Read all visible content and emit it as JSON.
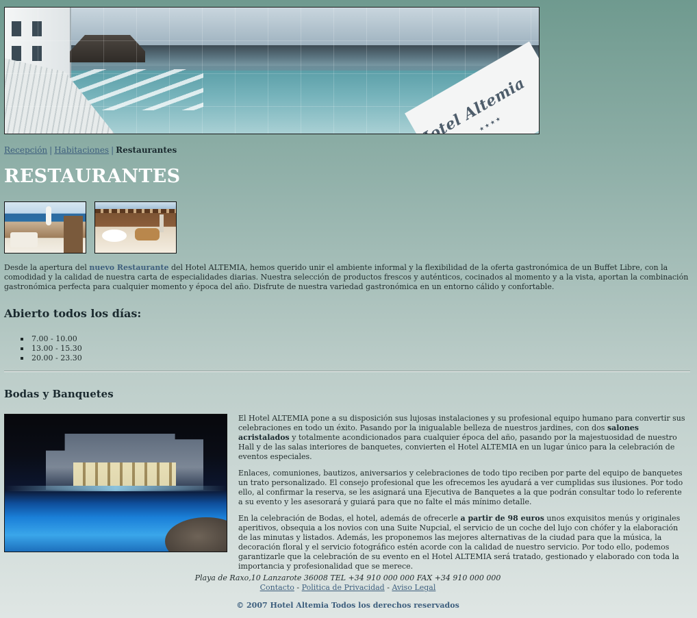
{
  "banner": {
    "logo_text": "Hotel Altemia",
    "logo_stars": "★★★★"
  },
  "breadcrumb": {
    "items": [
      "Recepción",
      "Habitaciones"
    ],
    "separator": "|",
    "current": "Restaurantes"
  },
  "page_title": "RESTAURANTES",
  "intro": {
    "part1": "Desde la apertura del ",
    "highlight": "nuevo Restaurante",
    "part2": " del Hotel ALTEMIA, hemos querido unir el ambiente informal y la flexibilidad de la oferta gastronómica de un Buffet Libre, con la comodidad y la calidad de nuestra carta de especialidades diarias. Nuestra selección de productos frescos y auténticos, cocinados al momento y a la vista, aportan la combinación gastronómica perfecta para cualquier momento y época del año. Disfrute de nuestra variedad gastronómica en un entorno cálido y confortable."
  },
  "opening": {
    "title": "Abierto todos los días:",
    "hours": [
      "7.00 - 10.00",
      "13.00 - 15.30",
      "20.00 - 23.30"
    ]
  },
  "bodas": {
    "title": "Bodas y Banquetes",
    "p1_a": "El Hotel ALTEMIA pone a su disposición sus lujosas instalaciones y su profesional equipo humano para convertir sus celebraciones en todo un éxito. Pasando por la inigualable belleza de nuestros jardines, con dos ",
    "p1_bold": "salones acristalados",
    "p1_b": " y totalmente acondicionados para cualquier época del año, pasando por la majestuosidad de nuestro Hall y de las salas interiores de banquetes, convierten el Hotel ALTEMIA en un lugar único para la celebración de eventos especiales.",
    "p2": "Enlaces, comuniones, bautizos, aniversarios y celebraciones de todo tipo reciben por parte del equipo de banquetes un trato personalizado. El consejo profesional que les ofrecemos les ayudará a ver cumplidas sus ilusiones. Por todo ello, al confirmar la reserva, se les asignará una Ejecutiva de Banquetes a la que podrán consultar todo lo referente a su evento y les asesorará y guiará para que no falte el más mínimo detalle.",
    "p3_a": "En la celebración de Bodas, el hotel, además de ofrecerle ",
    "p3_bold": "a partir de 98 euros",
    "p3_b": " unos exquisitos menús y originales aperitivos, obsequia a los novios con una Suite Nupcial, el servicio de un coche del lujo con chófer y la elaboración de las minutas y listados. Además, les proponemos las mejores alternativas de la ciudad para que la música, la decoración floral y el servicio fotográfico estén acorde con la calidad de nuestro servicio. Por todo ello, podemos garantizarle que la celebración de su evento en el Hotel ALTEMIA será tratado, gestionado y elaborado con toda la importancia y profesionalidad que se merece."
  },
  "footer": {
    "address": "Playa de Raxo,10 Lanzarote 36008 TEL +34 910 000 000 FAX +34 910 000 000",
    "links": [
      "Contacto",
      "Politica de Privacidad",
      "Aviso Legal"
    ],
    "link_separator": " - ",
    "copyright": "© 2007 Hotel Altemia Todos los derechos reservados"
  },
  "colors": {
    "link": "#3d5e7d",
    "title": "#ffffff",
    "background_top": "#6f9a8f",
    "background_bottom": "#dfe6e4"
  }
}
